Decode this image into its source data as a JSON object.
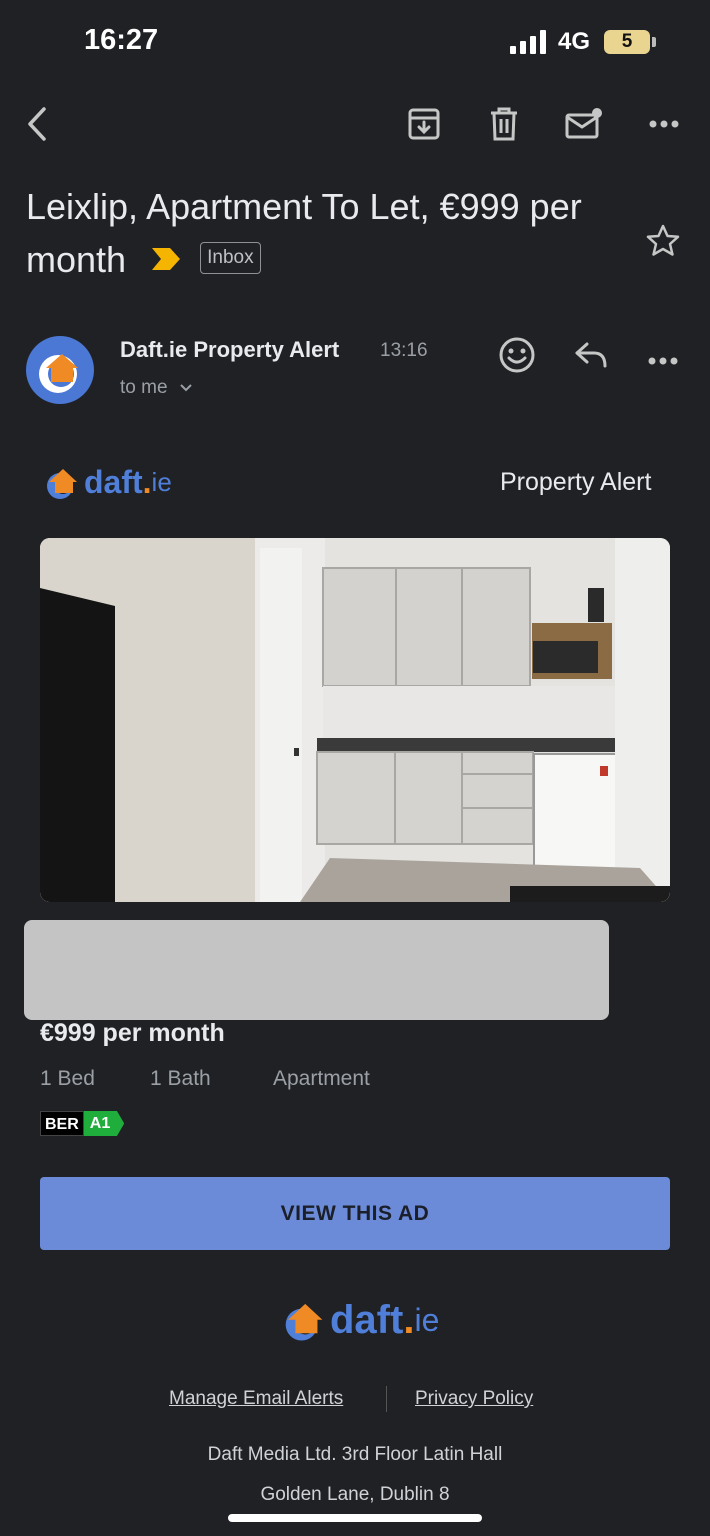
{
  "status_bar": {
    "time": "16:27",
    "network": "4G",
    "battery": "5"
  },
  "toolbar": {
    "back_icon": "chevron-left-icon",
    "archive_icon": "archive-icon",
    "delete_icon": "trash-icon",
    "mark_unread_icon": "mail-unread-icon",
    "more_icon": "more-horizontal-icon"
  },
  "subject": {
    "line1": "Leixlip, Apartment To Let, €999 per",
    "line2": "month",
    "label": "Inbox",
    "importance_icon": "important-marker-icon",
    "star_icon": "star-outline-icon"
  },
  "message": {
    "sender": "Daft.ie Property Alert",
    "time": "13:16",
    "recipient": "to me",
    "emoji_icon": "emoji-icon",
    "reply_icon": "reply-icon",
    "more_icon": "more-horizontal-icon"
  },
  "email": {
    "logo_daft": "daft",
    "logo_dot": ".",
    "logo_ie": "ie",
    "header_label": "Property Alert",
    "price": "€999 per month",
    "beds": "1 Bed",
    "baths": "1 Bath",
    "property_type": "Apartment",
    "ber_label": "BER",
    "ber_rating": "A1",
    "cta": "VIEW THIS AD",
    "footer_links": [
      "Manage Email Alerts",
      "Privacy Policy"
    ],
    "address_line1": "Daft Media Ltd. 3rd Floor Latin Hall",
    "address_line2": "Golden Lane, Dublin 8"
  },
  "colors": {
    "background": "#202125",
    "accent_blue": "#6b8bd8",
    "brand_orange": "#f08a24",
    "brand_blue": "#4f7fd9",
    "importance": "#f5b400",
    "ber_green": "#1fae3b"
  }
}
